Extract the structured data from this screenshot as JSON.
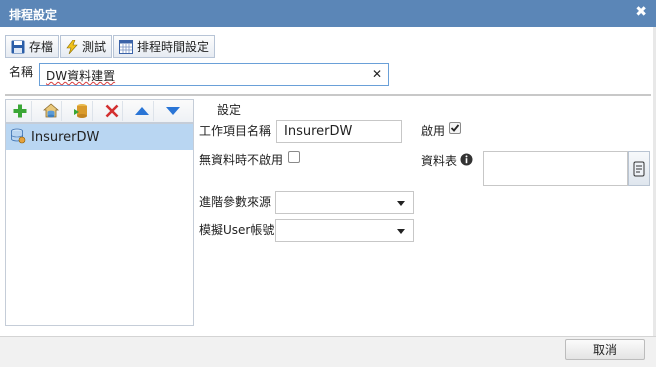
{
  "dialog": {
    "title": "排程設定",
    "close_glyph": "✖"
  },
  "toolbar": {
    "save_label": "存檔",
    "test_label": "測試",
    "schedule_time_label": "排程時間設定"
  },
  "name": {
    "label": "名稱",
    "value": "DW資料建置",
    "clear_glyph": "✕"
  },
  "tree": {
    "items": [
      {
        "label": "InsurerDW"
      }
    ]
  },
  "settings": {
    "title": "設定",
    "task_name_label": "工作項目名稱",
    "task_name_value": "InsurerDW",
    "enabled_label": "啟用",
    "enabled": true,
    "no_data_disable_label": "無資料時不啟用",
    "no_data_disable": false,
    "data_table_label": "資料表",
    "data_table_value": "",
    "advanced_param_source_label": "進階參數來源",
    "advanced_param_source_value": "",
    "simulate_user_label": "模擬User帳號",
    "simulate_user_value": ""
  },
  "footer": {
    "cancel_label": "取消"
  },
  "colors": {
    "titlebar": "#5b86b7",
    "selection": "#b9d6f2",
    "add_icon": "#3aa635",
    "delete_icon": "#d32f2f",
    "arrow_icon": "#2a75d6"
  }
}
